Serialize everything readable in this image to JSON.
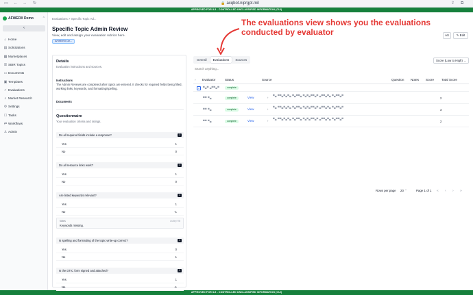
{
  "browser": {
    "url": "acqbot.niprgpt.mil",
    "back_icon": "arrow-left-icon",
    "forward_icon": "arrow-right-icon",
    "reload_icon": "reload-icon"
  },
  "banner": "APPROVED FOR IL5 - CONTROLLED UNCLASSIFIED INFORMATION (CUI)",
  "sidebar": {
    "org_name": "AFWERX Demo",
    "collapse_label": "‹",
    "items": [
      {
        "label": "Home",
        "icon": "home-icon"
      },
      {
        "label": "Solicitations",
        "icon": "document-icon"
      },
      {
        "label": "Marketplaces",
        "icon": "store-icon"
      },
      {
        "label": "SBIR Topics",
        "icon": "list-icon"
      },
      {
        "label": "Documents",
        "icon": "folder-icon"
      },
      {
        "label": "Templates",
        "icon": "template-icon"
      },
      {
        "label": "Evaluations",
        "icon": "check-icon"
      },
      {
        "label": "Market Research",
        "icon": "search-icon"
      },
      {
        "label": "Settings",
        "icon": "gear-icon"
      },
      {
        "label": "Tasks",
        "icon": "task-icon"
      },
      {
        "label": "Workflows",
        "icon": "workflow-icon"
      },
      {
        "label": "Admin",
        "icon": "admin-icon"
      }
    ]
  },
  "header": {
    "breadcrumb": "Evaluations >   Specific Topic Ad...",
    "title": "Specific Topic Admin Review",
    "subtitle": "View, edit and assign your evaluation rubrics here.",
    "tag": "AFWERX De...",
    "buttons": {
      "ai": "AS",
      "edit": "Edit"
    }
  },
  "annotation": "The evaluations view shows you the evaluations conducted by evaluator",
  "details": {
    "title": "Details",
    "subtitle": "Evaluation instructions and sources.",
    "instructions_label": "Instructions",
    "instructions_text": "The Admin Reviews are completed after topics are entered. It checks for required fields being filled, working links, keywords, and formatting/spelling.",
    "documents_label": "Documents"
  },
  "questionnaire": {
    "title": "Questionnaire",
    "subtitle": "Your evaluation criteria and ratings.",
    "questions": [
      {
        "text": "Do all required fields include a response?",
        "count": "1",
        "answers": [
          {
            "label": "Yes",
            "value": "1"
          },
          {
            "label": "No",
            "value": "0"
          }
        ]
      },
      {
        "text": "Do all resource links work?",
        "count": "1",
        "answers": [
          {
            "label": "Yes",
            "value": "1"
          },
          {
            "label": "No",
            "value": "0"
          }
        ]
      },
      {
        "text": "Are listed keywords relevant?",
        "count": "1",
        "answers": [
          {
            "label": "Yes",
            "value": "1"
          },
          {
            "label": "No",
            "value": "-1"
          }
        ],
        "notes": {
          "label": "Notes",
          "text": "Keywords missing.",
          "author": "Ashley Hill"
        }
      },
      {
        "text": "Is spelling and formatting of the topic write-up correct?",
        "count": "1",
        "answers": [
          {
            "label": "Yes",
            "value": "0"
          },
          {
            "label": "No",
            "value": "1"
          }
        ]
      },
      {
        "text": "Is the DTIC form signed and attached?",
        "count": "1",
        "answers": [
          {
            "label": "Yes",
            "value": "1"
          },
          {
            "label": "No",
            "value": "-1"
          }
        ]
      }
    ]
  },
  "evaluations": {
    "tabs": [
      "Overall",
      "Evaluations",
      "Sources"
    ],
    "active_tab": "Evaluations",
    "search_placeholder": "Search anything...",
    "sort_label": "Score (Low to High)",
    "columns": [
      "Evaluator",
      "Status",
      "Source",
      "Question",
      "Notes",
      "Score",
      "Total Score"
    ],
    "group_row": {
      "evaluator": "▀▄▀ ▄▀▀▄▀",
      "status": "complete"
    },
    "rows": [
      {
        "evaluator": "▀▀ ▀▄",
        "status": "complete",
        "action": "View",
        "source": "▀▄ ▀▀▄▀▄▀▄ ▀▄▀▀▄ ▀▄▀▄▀▀▄▀ ▄▀▀▄▀▄ ▀▄▀▀▄▀",
        "total": "2"
      },
      {
        "evaluator": "▀▀ ▀▄",
        "status": "complete",
        "action": "View",
        "source": "▀▄ ▀▀▄▀▄▀▄ ▀▄▀▀▄ ▀▄▀▄▀▀▄▀ ▄▀▀▄▀▄ ▀▄▀▀▄▀",
        "total": "3"
      },
      {
        "evaluator": "▀▀ ▀▄",
        "status": "complete",
        "action": "View",
        "source": "▀▄ ▀▀▄▀▄▀▄ ▀▄▀▀▄ ▀▄▀▄▀▀▄▀ ▄▀▀▄▀▄ ▀▄▀▀▄▀",
        "total": "2"
      }
    ],
    "pager": {
      "rows_per_page_label": "Rows per page",
      "rows_per_page": "20",
      "page_text": "Page 1 of 1"
    }
  },
  "colors": {
    "banner": "#16803c",
    "annotation": "#e53935",
    "badge": "#dcfce7",
    "link": "#2563eb"
  }
}
